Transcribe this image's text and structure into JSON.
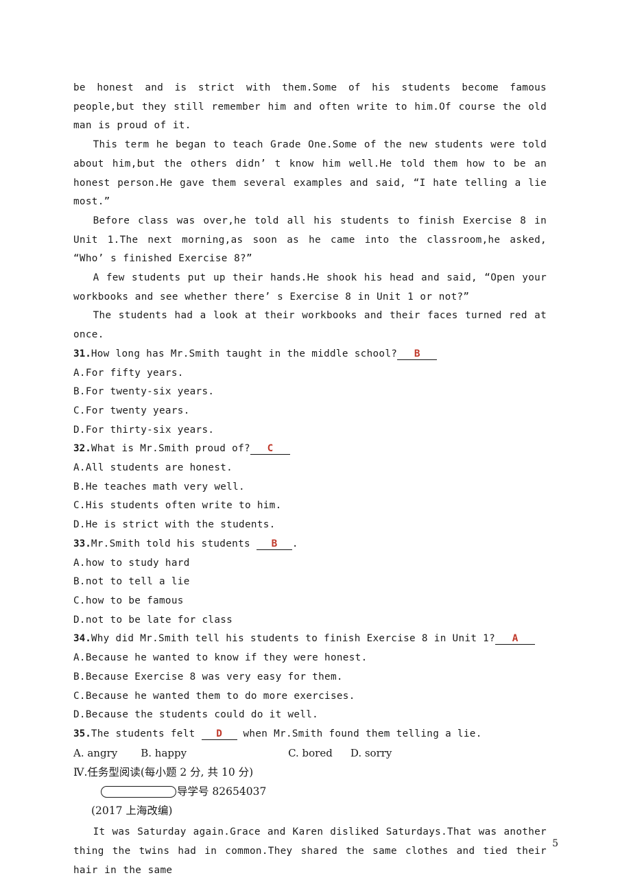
{
  "document": {
    "page_number": "5",
    "answer_color": "#c0392b"
  },
  "passage": {
    "paragraphs": [
      "be honest and is strict with them.Some of his students become famous people,but they still remember him and often write to him.Of course the old man is proud of it.",
      "This term he began to teach Grade One.Some of the new students were told about him,but the others didn’ t know him well.He told them how to be an honest person.He gave them several examples and said, “I hate telling a lie most.”",
      "Before class was over,he told all his students to finish Exercise 8 in Unit 1.The next morning,as soon as he came into the classroom,he asked, “Who’ s finished Exercise 8?”",
      "A few students put up their hands.He shook his head and said, “Open your workbooks and see whether there’ s Exercise 8 in Unit 1 or not?”",
      "The students had a look at their workbooks and their faces turned red at once."
    ]
  },
  "questions": [
    {
      "number": "31.",
      "stem_before": "How long has Mr.Smith taught in the middle school?",
      "answer": "B",
      "stem_after": "",
      "options": [
        "A.For fifty years.",
        "B.For twenty-six years.",
        "C.For twenty years.",
        "D.For thirty-six years."
      ]
    },
    {
      "number": "32.",
      "stem_before": "What is Mr.Smith proud of?",
      "answer": "C",
      "stem_after": "",
      "options": [
        "A.All students are honest.",
        "B.He teaches math very well.",
        "C.His students often write to him.",
        "D.He is strict with the students."
      ]
    },
    {
      "number": "33.",
      "stem_before": "Mr.Smith told his students ",
      "answer": "B",
      "stem_after": ".",
      "options": [
        "A.how to study hard",
        "B.not to tell a lie",
        "C.how to be famous",
        "D.not to be late for class"
      ]
    },
    {
      "number": "34.",
      "stem_before": "Why did Mr.Smith tell his students to finish Exercise 8 in Unit 1?",
      "answer": "A",
      "stem_after": "",
      "options": [
        "A.Because he wanted to know if they were honest.",
        "B.Because Exercise 8 was very easy for them.",
        "C.Because he wanted them to do more exercises.",
        "D.Because the students could do it well."
      ]
    },
    {
      "number": "35.",
      "stem_before": "The students felt ",
      "answer": "D",
      "stem_after": " when Mr.Smith found them telling a lie.",
      "inline_options": {
        "a": "A. angry",
        "b": "B. happy",
        "c": "C. bored",
        "d": "D. sorry"
      }
    }
  ],
  "section": {
    "heading": "Ⅳ.任务型阅读(每小题 2 分, 共 10 分)",
    "daoxue_label": "导学号 82654037",
    "source": "(2017 上海改编)",
    "passage_paragraph": "It was Saturday again.Grace and Karen disliked Saturdays.That was another thing the twins had in common.They shared the same clothes and tied their hair in the same"
  }
}
